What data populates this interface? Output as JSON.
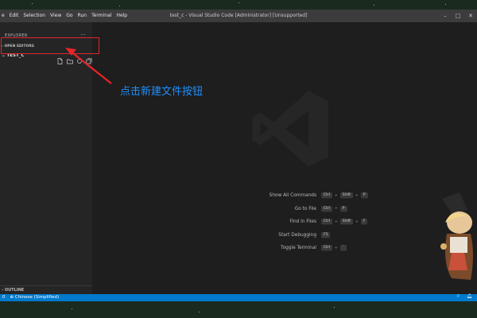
{
  "window": {
    "title": "test_c - Visual Studio Code [Administrator] [Unsupported]"
  },
  "menu": [
    "e",
    "Edit",
    "Selection",
    "View",
    "Go",
    "Run",
    "Terminal",
    "Help"
  ],
  "sidebar": {
    "explorer_label": "EXPLORER",
    "more_label": "···",
    "open_editors_label": "OPEN EDITORS",
    "folder_label": "TEST_C",
    "outline_label": "OUTLINE",
    "folder_actions": [
      "new-file-icon",
      "new-folder-icon",
      "refresh-icon",
      "collapse-all-icon"
    ]
  },
  "annotation": {
    "text": "点击新建文件按钮"
  },
  "shortcuts": [
    {
      "label": "Show All Commands",
      "keys": [
        "Ctrl",
        "+",
        "Shift",
        "+",
        "P"
      ]
    },
    {
      "label": "Go to File",
      "keys": [
        "Ctrl",
        "+",
        "P"
      ]
    },
    {
      "label": "Find in Files",
      "keys": [
        "Ctrl",
        "+",
        "Shift",
        "+",
        "F"
      ]
    },
    {
      "label": "Start Debugging",
      "keys": [
        "F5"
      ]
    },
    {
      "label": "Toggle Terminal",
      "keys": [
        "Ctrl",
        "+",
        "`"
      ]
    }
  ],
  "statusbar": {
    "left_count": "0",
    "language": "Chinese (Simplified)"
  },
  "colors": {
    "accent": "#007acc",
    "annotation_box": "#e6252a",
    "annotation_text": "#1e90ff"
  }
}
